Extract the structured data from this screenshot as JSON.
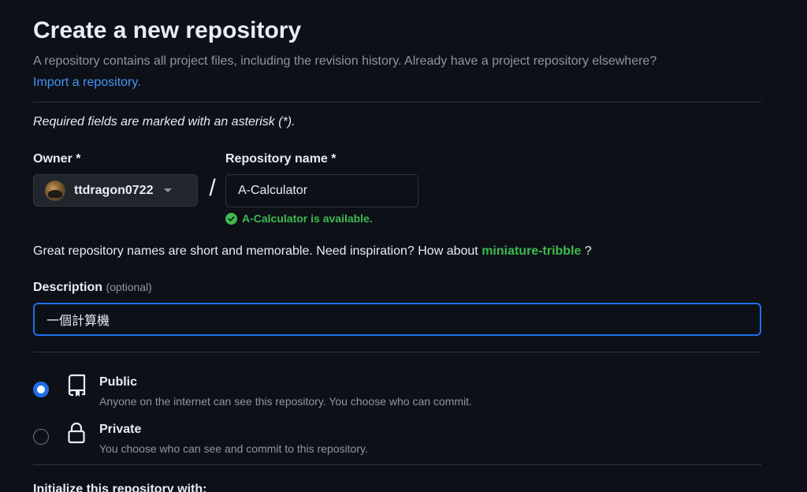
{
  "header": {
    "title": "Create a new repository",
    "subtitle": "A repository contains all project files, including the revision history. Already have a project repository elsewhere?",
    "import_link": "Import a repository."
  },
  "required_note": "Required fields are marked with an asterisk (*).",
  "owner": {
    "label": "Owner *",
    "value": "ttdragon0722"
  },
  "separator": "/",
  "repo_name": {
    "label": "Repository name *",
    "value": "A-Calculator",
    "availability": "A-Calculator is available."
  },
  "suggestion": {
    "text": "Great repository names are short and memorable. Need inspiration? How about",
    "name": "miniature-tribble",
    "suffix": " ?"
  },
  "description": {
    "label": "Description",
    "optional": "(optional)",
    "value": "一個計算機"
  },
  "visibility": {
    "selected": "public",
    "options": [
      {
        "title": "Public",
        "desc": "Anyone on the internet can see this repository. You choose who can commit.",
        "icon": "repo-icon"
      },
      {
        "title": "Private",
        "desc": "You choose who can see and commit to this repository.",
        "icon": "lock-icon"
      }
    ]
  },
  "initialize": {
    "heading": "Initialize this repository with:"
  },
  "colors": {
    "background": "#0d1117",
    "accent": "#1f6feb",
    "link": "#4493f8",
    "success": "#3fb950",
    "muted": "#8d96a0"
  }
}
